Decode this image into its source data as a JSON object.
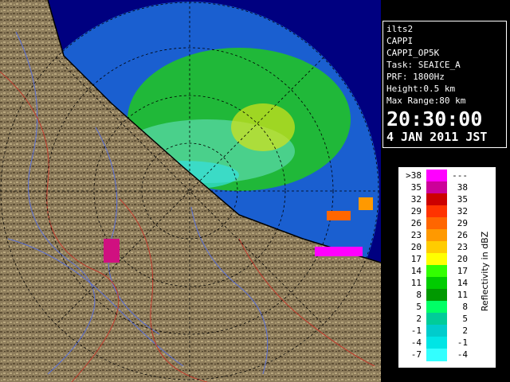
{
  "info": {
    "radar_name": "ilts2",
    "product": "CAPPI",
    "product_task": "CAPPI_OP5K",
    "task": "Task: SEAICE_A",
    "prf": "PRF: 1800Hz",
    "height": "Height:0.5 km",
    "max_range": "Max Range:80 km",
    "time": "20:30:00",
    "date": "4 JAN 2011 JST"
  },
  "legend": {
    "unit": "Reflectivity in dBZ",
    "rows": [
      {
        "low": ">38",
        "high": "---",
        "color": "#ff00ff"
      },
      {
        "low": "35",
        "high": "38",
        "color": "#cc0099"
      },
      {
        "low": "32",
        "high": "35",
        "color": "#cc0000"
      },
      {
        "low": "29",
        "high": "32",
        "color": "#ff3300"
      },
      {
        "low": "26",
        "high": "29",
        "color": "#ff6600"
      },
      {
        "low": "23",
        "high": "26",
        "color": "#ff9900"
      },
      {
        "low": "20",
        "high": "23",
        "color": "#ffcc00"
      },
      {
        "low": "17",
        "high": "20",
        "color": "#ffff00"
      },
      {
        "low": "14",
        "high": "17",
        "color": "#33ff00"
      },
      {
        "low": "11",
        "high": "14",
        "color": "#00cc00"
      },
      {
        "low": "8",
        "high": "11",
        "color": "#009900"
      },
      {
        "low": "5",
        "high": "8",
        "color": "#00ff66"
      },
      {
        "low": "2",
        "high": "5",
        "color": "#00cc99"
      },
      {
        "low": "-1",
        "high": "2",
        "color": "#00cccc"
      },
      {
        "low": "-4",
        "high": "-1",
        "color": "#00e5e5"
      },
      {
        "low": "-7",
        "high": "-4",
        "color": "#33ffff"
      }
    ]
  },
  "colors": {
    "sea": "#1a5fd0",
    "outer": "#000080",
    "land": "#8a7a5a"
  }
}
